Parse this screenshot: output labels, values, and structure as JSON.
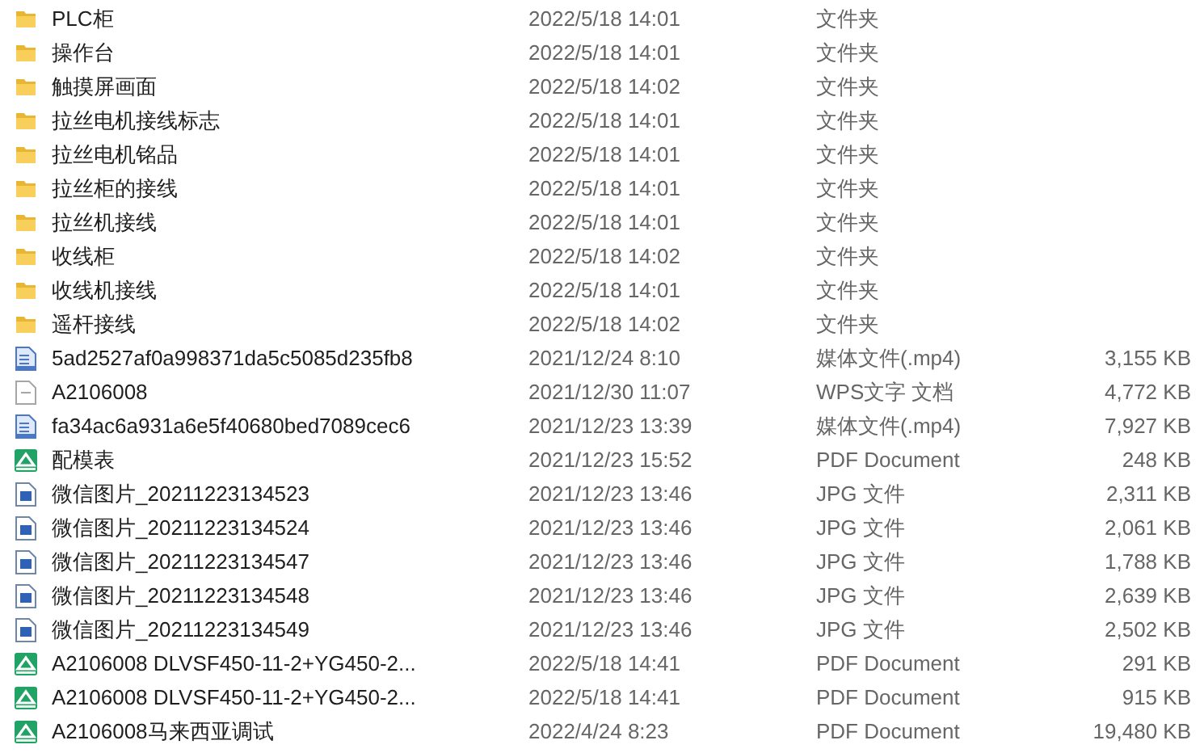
{
  "files": [
    {
      "kind": "folder",
      "name": "PLC柜",
      "modified": "2022/5/18 14:01",
      "type": "文件夹"
    },
    {
      "kind": "folder",
      "name": "操作台",
      "modified": "2022/5/18 14:01",
      "type": "文件夹"
    },
    {
      "kind": "folder",
      "name": "触摸屏画面",
      "modified": "2022/5/18 14:02",
      "type": "文件夹"
    },
    {
      "kind": "folder",
      "name": "拉丝电机接线标志",
      "modified": "2022/5/18 14:01",
      "type": "文件夹"
    },
    {
      "kind": "folder",
      "name": "拉丝电机铭品",
      "modified": "2022/5/18 14:01",
      "type": "文件夹"
    },
    {
      "kind": "folder",
      "name": "拉丝柜的接线",
      "modified": "2022/5/18 14:01",
      "type": "文件夹"
    },
    {
      "kind": "folder",
      "name": "拉丝机接线",
      "modified": "2022/5/18 14:01",
      "type": "文件夹"
    },
    {
      "kind": "folder",
      "name": "收线柜",
      "modified": "2022/5/18 14:02",
      "type": "文件夹"
    },
    {
      "kind": "folder",
      "name": "收线机接线",
      "modified": "2022/5/18 14:01",
      "type": "文件夹"
    },
    {
      "kind": "folder",
      "name": "遥杆接线",
      "modified": "2022/5/18 14:02",
      "type": "文件夹"
    },
    {
      "kind": "video",
      "name": "5ad2527af0a998371da5c5085d235fb8",
      "modified": "2021/12/24 8:10",
      "type": "媒体文件(.mp4)",
      "size": "3,155 KB"
    },
    {
      "kind": "wps",
      "name": "A2106008",
      "modified": "2021/12/30 11:07",
      "type": "WPS文字 文档",
      "size": "4,772 KB"
    },
    {
      "kind": "video",
      "name": "fa34ac6a931a6e5f40680bed7089cec6",
      "modified": "2021/12/23 13:39",
      "type": "媒体文件(.mp4)",
      "size": "7,927 KB"
    },
    {
      "kind": "pdf",
      "name": "配模表",
      "modified": "2021/12/23 15:52",
      "type": "PDF Document",
      "size": "248 KB"
    },
    {
      "kind": "image",
      "name": "微信图片_20211223134523",
      "modified": "2021/12/23 13:46",
      "type": "JPG 文件",
      "size": "2,311 KB"
    },
    {
      "kind": "image",
      "name": "微信图片_20211223134524",
      "modified": "2021/12/23 13:46",
      "type": "JPG 文件",
      "size": "2,061 KB"
    },
    {
      "kind": "image",
      "name": "微信图片_20211223134547",
      "modified": "2021/12/23 13:46",
      "type": "JPG 文件",
      "size": "1,788 KB"
    },
    {
      "kind": "image",
      "name": "微信图片_20211223134548",
      "modified": "2021/12/23 13:46",
      "type": "JPG 文件",
      "size": "2,639 KB"
    },
    {
      "kind": "image",
      "name": "微信图片_20211223134549",
      "modified": "2021/12/23 13:46",
      "type": "JPG 文件",
      "size": "2,502 KB"
    },
    {
      "kind": "pdf",
      "name": "A2106008 DLVSF450-11-2+YG450-2...",
      "modified": "2022/5/18 14:41",
      "type": "PDF Document",
      "size": "291 KB"
    },
    {
      "kind": "pdf",
      "name": "A2106008 DLVSF450-11-2+YG450-2...",
      "modified": "2022/5/18 14:41",
      "type": "PDF Document",
      "size": "915 KB"
    },
    {
      "kind": "pdf",
      "name": "A2106008马来西亚调试",
      "modified": "2022/4/24 8:23",
      "type": "PDF Document",
      "size": "19,480 KB"
    }
  ]
}
